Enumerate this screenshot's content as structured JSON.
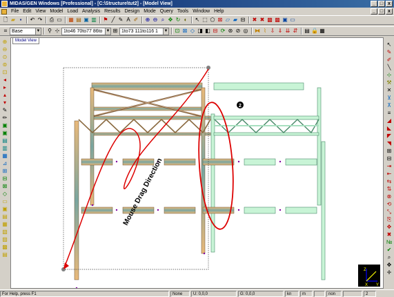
{
  "window": {
    "title": "MIDAS/GEN Windows [Professional] - [C:\\Structure\\tut2] - [Model View]",
    "min": "_",
    "restore": "□",
    "close": "x"
  },
  "menu": [
    "File",
    "Edit",
    "View",
    "Model",
    "Load",
    "Analysis",
    "Results",
    "Design",
    "Mode",
    "Query",
    "Tools",
    "Window",
    "Help"
  ],
  "toolbar1": {
    "icons": [
      "new-icon",
      "open-icon",
      "save-icon",
      "undo-icon",
      "redo-icon",
      "print-icon",
      "preview-icon",
      "zoom-window-icon",
      "zoom-fit-icon",
      "pan-icon",
      "rotate-icon",
      "hidden-icon",
      "shrink-icon",
      "render-icon",
      "display-icon",
      "node-number-icon",
      "element-number-icon",
      "select-icon",
      "window-select-icon",
      "polygon-select-icon",
      "unselect-icon",
      "activate-icon",
      "inactivate-icon",
      "delete-icon",
      "copy-icon",
      "move-icon",
      "divide-icon",
      "translate-icon",
      "rotate-copy-icon",
      "mirror-icon"
    ]
  },
  "toolbar2": {
    "combo_label": "Base",
    "select_combo1": "1to46 70to77 86to",
    "select_combo2": "1to73 111to116 1"
  },
  "tab": {
    "label": "Model View"
  },
  "annotations": {
    "drag_label": "Mouse Drag Direction",
    "callout_number": "2"
  },
  "status": {
    "help": "For Help, press F1",
    "selection": "None",
    "u_coord": "U: 0,0,0",
    "g_coord": "G: 0,0,0",
    "unit_force": "kn",
    "unit_length": "m",
    "view_mode": "non",
    "page": "2"
  },
  "axis": {
    "x_label": "X",
    "y_label": "Y",
    "z_label": "Z"
  },
  "colors": {
    "titlebar": "#0a246a",
    "selected_member": "#c8a46a",
    "unselected_member": "#b8f0c8",
    "drag_curve": "#dd0000"
  }
}
